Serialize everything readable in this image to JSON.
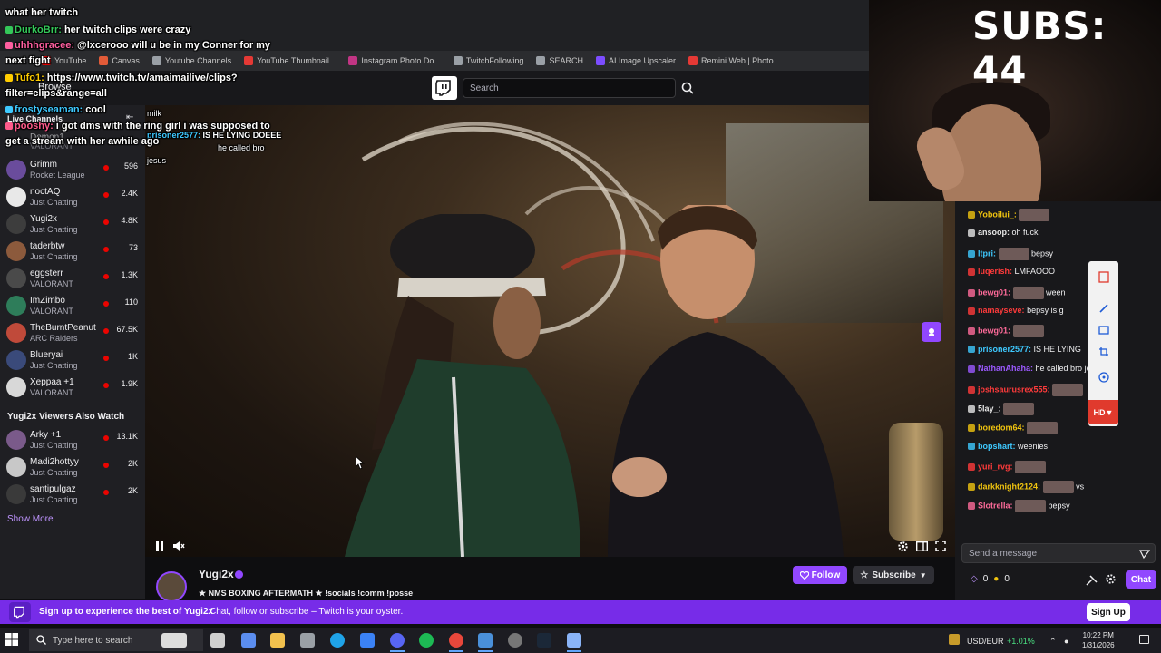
{
  "bookmarks": [
    {
      "label": "YouTube",
      "color": "#ff0000"
    },
    {
      "label": "Canvas",
      "color": "#e25b38"
    },
    {
      "label": "Youtube Channels",
      "color": "#9aa0a6"
    },
    {
      "label": "YouTube Thumbnail...",
      "color": "#e53935"
    },
    {
      "label": "Instagram Photo Do...",
      "color": "#c13584"
    },
    {
      "label": "TwitchFollowing",
      "color": "#9aa0a6"
    },
    {
      "label": "SEARCH",
      "color": "#9aa0a6"
    },
    {
      "label": "AI Image Upscaler",
      "color": "#7c4dff"
    },
    {
      "label": "Remini Web | Photo...",
      "color": "#e53935"
    }
  ],
  "header": {
    "search_placeholder": "Search",
    "browse": "Browse"
  },
  "sidebar": {
    "heading": "Live Channels",
    "collapse_icon": "⇤",
    "partial_channel": {
      "name": "Demon1",
      "game": "VALORANT"
    },
    "channels": [
      {
        "name": "Grimm",
        "game": "Rocket League",
        "viewers": "596",
        "color": "#6a4c9c"
      },
      {
        "name": "noctAQ",
        "game": "Just Chatting",
        "viewers": "2.4K",
        "color": "#e8e8e8"
      },
      {
        "name": "Yugi2x",
        "game": "Just Chatting",
        "viewers": "4.8K",
        "color": "#3d3d3d"
      },
      {
        "name": "taderbtw",
        "game": "Just Chatting",
        "viewers": "73",
        "color": "#8c5a3c"
      },
      {
        "name": "eggsterr",
        "game": "VALORANT",
        "viewers": "1.3K",
        "color": "#4a4a4a"
      },
      {
        "name": "ImZimbo",
        "game": "VALORANT",
        "viewers": "110",
        "color": "#2e7d5a"
      },
      {
        "name": "TheBurntPeanut",
        "game": "ARC Raiders",
        "viewers": "67.5K",
        "color": "#c04a3a"
      },
      {
        "name": "Blueryai",
        "game": "Just Chatting",
        "viewers": "1K",
        "color": "#3a4a7a"
      },
      {
        "name": "Xeppaa +1",
        "game": "VALORANT",
        "viewers": "1.9K",
        "color": "#d8d8d8"
      }
    ],
    "also_watch_heading": "Yugi2x Viewers Also Watch",
    "also_watch": [
      {
        "name": "Arky +1",
        "game": "Just Chatting",
        "viewers": "13.1K",
        "color": "#7a5a8a"
      },
      {
        "name": "Madi2hottyy",
        "game": "Just Chatting",
        "viewers": "2K",
        "color": "#c8c8c8"
      },
      {
        "name": "santipulgaz",
        "game": "Just Chatting",
        "viewers": "2K",
        "color": "#3a3a3a"
      }
    ],
    "show_more": "Show More"
  },
  "overlay_chat": [
    {
      "user": "",
      "msg": "what her twitch",
      "color": "#d8d8d8"
    },
    {
      "user": "DurkoBrr:",
      "msg": "her twitch clips were crazy",
      "color": "#34c759"
    },
    {
      "user": "uhhhgracee:",
      "msg": "@lxcerooo will u be in my Conner for my",
      "color": "#ff5fa0"
    },
    {
      "user": "",
      "msg": "next fight",
      "color": "#ffffff"
    },
    {
      "user": "Tufo1:",
      "msg": "https://www.twitch.tv/amaimailive/clips?",
      "color": "#ffcc00"
    },
    {
      "user": "",
      "msg": "filter=clips&range=all",
      "color": "#ffffff"
    },
    {
      "user": "frostyseaman:",
      "msg": "cool",
      "color": "#3ec9ff"
    },
    {
      "user": "pooshy:",
      "msg": "i got dms with the ring girl i was supposed to",
      "color": "#ff5a8a"
    },
    {
      "user": "",
      "msg": "get a stream with her awhile ago",
      "color": "#ffffff"
    }
  ],
  "overlay_video_chat": {
    "line1": "milk",
    "line2_user": "prisoner2577:",
    "line2_msg": "IS HE LYING DOEEE",
    "line3": "he called bro",
    "line4": "jesus"
  },
  "subs_counter": "SUBS: 44",
  "chat": {
    "lines": [
      {
        "user": "Yoboilui_:",
        "msg": "",
        "user_color": "#f1c40f"
      },
      {
        "user": "ansoop:",
        "msg": "oh fuck",
        "user_color": "#e6e6e6"
      },
      {
        "user": "ltpri:",
        "msg": "bepsy",
        "user_color": "#3ec9ff"
      },
      {
        "user": "luqerish:",
        "msg": "LMFAOOO",
        "user_color": "#ff3b3b"
      },
      {
        "user": "bewg01:",
        "msg": "ween",
        "user_color": "#ff6b9a"
      },
      {
        "user": "namayseve:",
        "msg": "bepsy is g",
        "user_color": "#ff3b3b"
      },
      {
        "user": "bewg01:",
        "msg": "",
        "user_color": "#ff6b9a"
      },
      {
        "user": "prisoner2577:",
        "msg": "IS HE LYING",
        "user_color": "#3ec9ff"
      },
      {
        "user": "NathanAhaha:",
        "msg": "he called bro je",
        "user_color": "#9b59ff"
      },
      {
        "user": "joshsaurusrex555:",
        "msg": "",
        "user_color": "#ff3b3b"
      },
      {
        "user": "5lay_:",
        "msg": "",
        "user_color": "#e6e6e6"
      },
      {
        "user": "boredom64:",
        "msg": "",
        "user_color": "#f1c40f"
      },
      {
        "user": "bopshart:",
        "msg": "weenies",
        "user_color": "#3ec9ff"
      },
      {
        "user": "yuri_rvg:",
        "msg": "",
        "user_color": "#ff3b3b"
      },
      {
        "user": "darkknight2124:",
        "msg": "vs",
        "user_color": "#f1c40f"
      },
      {
        "user": "Slotrella:",
        "msg": "bepsy",
        "user_color": "#ff6b9a"
      }
    ],
    "input_placeholder": "Send a message",
    "points_a": "0",
    "points_b": "0",
    "chat_button": "Chat",
    "hd_label": "HD▼"
  },
  "stream": {
    "streamer": "Yugi2x",
    "title": "★ NMS BOXING AFTERMATH ★ !socials !comm !posse",
    "follow": "Follow",
    "subscribe": "Subscribe"
  },
  "banner": {
    "bold": "Sign up to experience the best of Yugi2x",
    "text": "Chat, follow or subscribe – Twitch is your oyster.",
    "signup": "Sign Up"
  },
  "taskbar": {
    "search": "Type here to search",
    "currency": "USD/EUR",
    "change": "+1.01%",
    "time": "10:22 PM",
    "date": "1/31/2026"
  },
  "colors": {
    "twitch_purple": "#9147ff",
    "banner_purple": "#772ce8",
    "live_red": "#eb0400"
  }
}
